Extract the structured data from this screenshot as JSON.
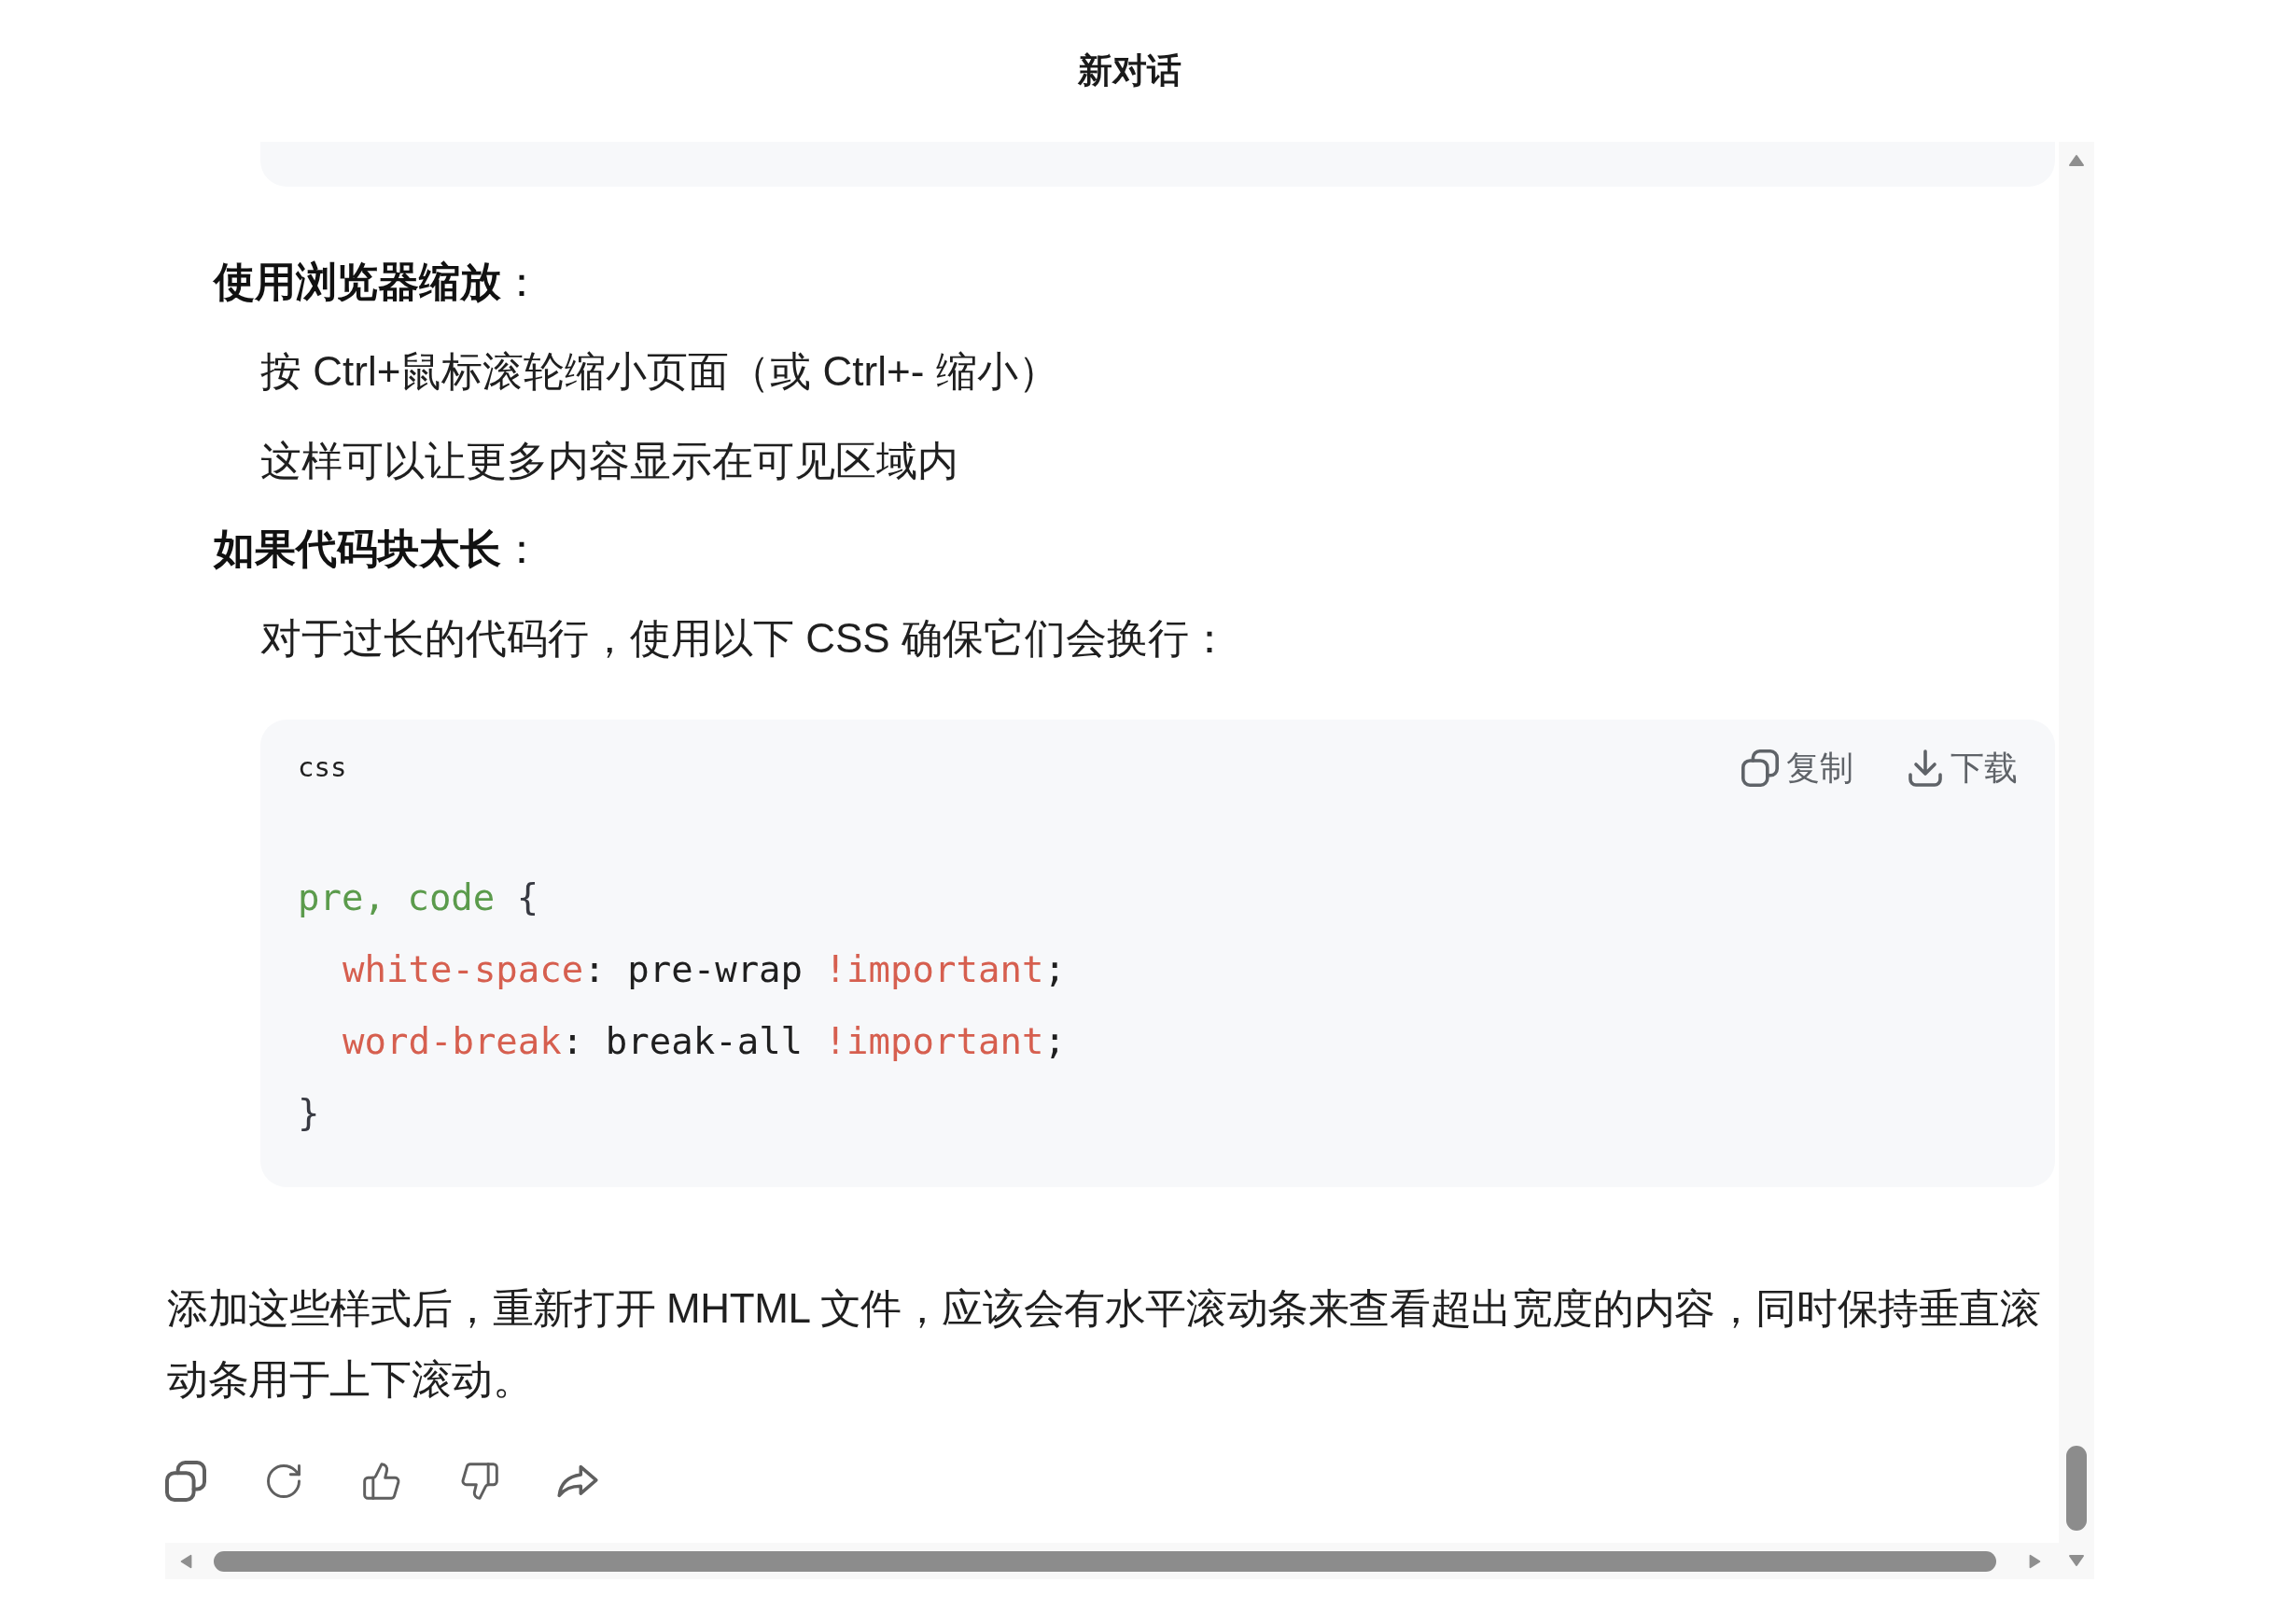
{
  "title": "新对话",
  "sections": [
    {
      "heading": "**使用浏览器缩放**：",
      "items": [
        "按 Ctrl+鼠标滚轮缩小页面（或 Ctrl+- 缩小）",
        "这样可以让更多内容显示在可见区域内"
      ]
    },
    {
      "heading": "**如果代码块太长**：",
      "items": [
        "对于过长的代码行，使用以下 CSS 确保它们会换行："
      ]
    }
  ],
  "code_block": {
    "language": "css",
    "buttons": [
      {
        "kind": "copy",
        "label": "复制"
      },
      {
        "kind": "download",
        "label": "下载"
      }
    ],
    "lines": [
      {
        "indented": false,
        "tokens": [
          {
            "kind": "selector",
            "text": "pre, code"
          },
          {
            "kind": "punct",
            "text": " {"
          }
        ]
      },
      {
        "indented": true,
        "tokens": [
          {
            "kind": "property",
            "text": "white-space"
          },
          {
            "kind": "plain",
            "text": ": pre-wrap "
          },
          {
            "kind": "keyword",
            "text": "!important"
          },
          {
            "kind": "plain",
            "text": ";"
          }
        ]
      },
      {
        "indented": true,
        "tokens": [
          {
            "kind": "property",
            "text": "word-break"
          },
          {
            "kind": "plain",
            "text": ": break-all "
          },
          {
            "kind": "keyword",
            "text": "!important"
          },
          {
            "kind": "plain",
            "text": ";"
          }
        ]
      },
      {
        "indented": false,
        "tokens": [
          {
            "kind": "punct",
            "text": "}"
          }
        ]
      }
    ]
  },
  "footer_text": "添加这些样式后，重新打开 MHTML 文件，应该会有水平滚动条来查看超出宽度的内容，同时保持垂直滚动条用于上下滚动。"
}
